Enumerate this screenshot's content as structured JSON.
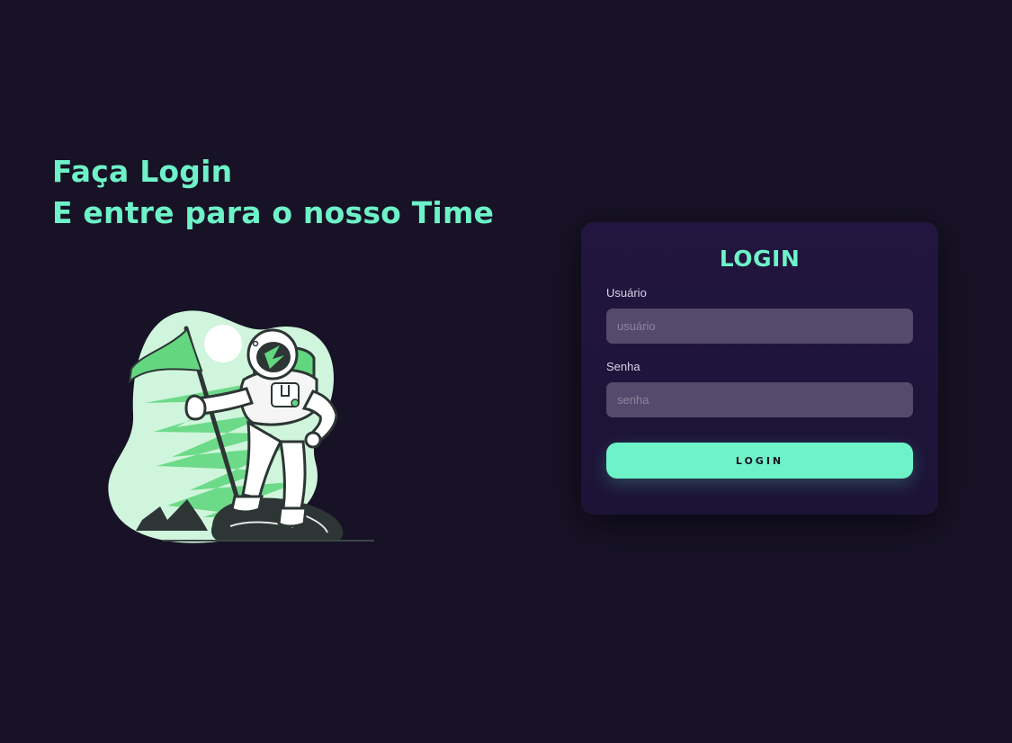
{
  "hero": {
    "line1": "Faça Login",
    "line2": "E entre para o nosso Time"
  },
  "illustration": {
    "icon": "astronaut-flag-illustration"
  },
  "login_card": {
    "title": "LOGIN",
    "username_label": "Usuário",
    "username_placeholder": "usuário",
    "password_label": "Senha",
    "password_placeholder": "senha",
    "button_label": "LOGIN"
  },
  "colors": {
    "background": "#171226",
    "accent": "#6ef2c8",
    "card": "#22153f",
    "input": "#554a6b"
  }
}
